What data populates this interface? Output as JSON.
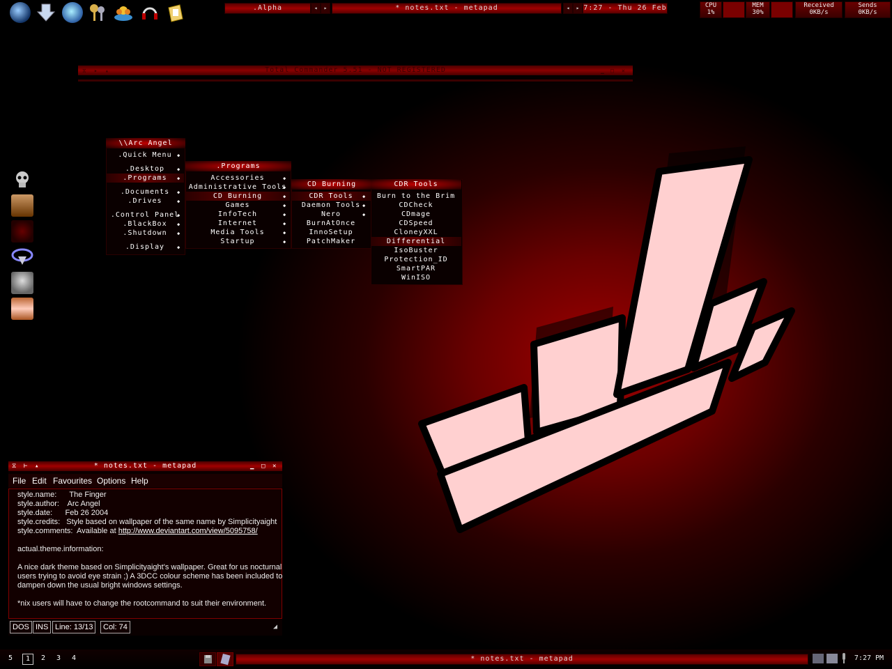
{
  "topbar": {
    "workspace": ".Alpha",
    "window_title": "* notes.txt - metapad",
    "clock": "7:27 - Thu 26 Feb",
    "nav_prev": "◂",
    "nav_next": "▸"
  },
  "stats": {
    "cpu_label": "CPU",
    "cpu_value": "1%",
    "mem_label": "MEM",
    "mem_value": "30%",
    "recv_label": "Received",
    "recv_value": "0KB/s",
    "send_label": "Sends",
    "send_value": "0KB/s"
  },
  "launcher_icons": [
    "globe-icon",
    "download-arrow-icon",
    "browser-icon",
    "keys-icon",
    "flower-icon",
    "headset-icon",
    "folder-note-icon"
  ],
  "side_icons": [
    "skull-icon",
    "demon-face-icon",
    "red-orb-icon",
    "blue-emblem-icon",
    "robot-head-icon",
    "woman-face-icon"
  ],
  "totalcmd": {
    "title": "Total Commander 5.51 - NOT REGISTERED"
  },
  "menus": {
    "root": {
      "title": "\\\\Arc Angel",
      "items": [
        ".Quick Menu",
        ".Desktop",
        ".Programs",
        ".Documents",
        ".Drives",
        ".Control Panel",
        ".BlackBox",
        ".Shutdown",
        ".Display"
      ]
    },
    "programs": {
      "title": ".Programs",
      "items": [
        "Accessories",
        "Administrative Tools",
        "CD Burning",
        "Games",
        "InfoTech",
        "Internet",
        "Media Tools",
        "Startup"
      ]
    },
    "cdburning": {
      "title": "CD Burning",
      "items": [
        "CDR Tools",
        "Daemon Tools",
        "Nero",
        "BurnAtOnce",
        "InnoSetup",
        "PatchMaker"
      ]
    },
    "cdrtools": {
      "title": "CDR Tools",
      "items": [
        "Burn to the Brim",
        "CDCheck",
        "CDmage",
        "CDSpeed",
        "CloneyXXL",
        "Differential",
        "IsoBuster",
        "Protection_ID",
        "SmartPAR",
        "WinISO"
      ]
    }
  },
  "metapad": {
    "title": "* notes.txt - metapad",
    "menu": [
      "File",
      "Edit",
      "Favourites",
      "Options",
      "Help"
    ],
    "lines": [
      "style.name:      The Finger",
      "style.author:    Arc Angel",
      "style.date:      Feb 26 2004",
      "style.credits:   Style based on wallpaper of the same name by Simplicityaight",
      "style.comments:  Available at ",
      "",
      "actual.theme.information:",
      "",
      "A nice dark theme based on Simplicityaight's wallpaper. Great for us nocturnal",
      "users trying to avoid eye strain ;) A 3DCC colour scheme has been included to",
      "dampen down the usual bright windows settings.",
      "",
      "*nix users will have to change the rootcommand to suit their environment."
    ],
    "link": "http://www.deviantart.com/view/5095758/",
    "status": {
      "mode": "DOS",
      "ins": "INS",
      "line": "Line: 13/13",
      "col": "Col: 74"
    }
  },
  "bottombar": {
    "workspaces": [
      "5",
      "1",
      "2",
      "3",
      "4"
    ],
    "task": "* notes.txt - metapad",
    "clock": "7:27 PM"
  },
  "colors": {
    "accent": "#a00000",
    "dark": "#0a0000",
    "logo_fill": "#ffd0d0"
  }
}
